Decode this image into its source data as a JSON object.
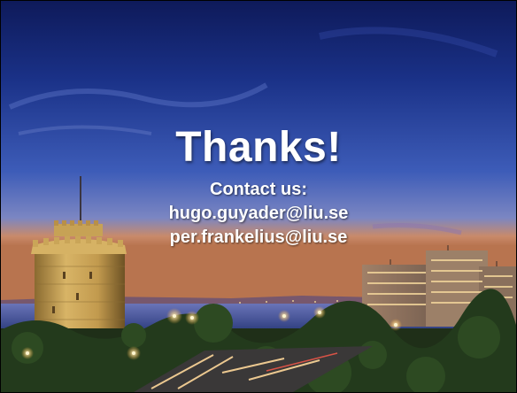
{
  "slide": {
    "title": "Thanks!",
    "contact_heading": "Contact us:",
    "emails": [
      "hugo.guyader@liu.se",
      "per.frankelius@liu.se"
    ]
  },
  "photo": {
    "scene": "white-tower-waterfront-dusk",
    "colors": {
      "sky_top": "#13246b",
      "sky_mid": "#3d5cb8",
      "horizon": "#c98a6a",
      "sea": "#4a63a8",
      "tower": "#c7a255",
      "foliage": "#1f2f18"
    }
  }
}
